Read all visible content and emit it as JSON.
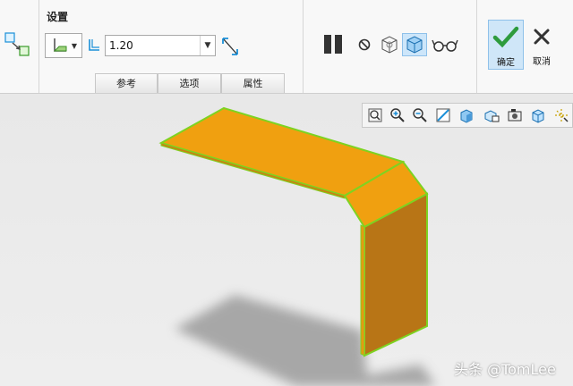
{
  "group_title": "设置",
  "thickness": {
    "value": "1.20"
  },
  "tabs": [
    "参考",
    "选项",
    "属性"
  ],
  "confirm": {
    "label": "确定"
  },
  "cancel": {
    "label": "取消"
  },
  "watermark": "头条 @TomLee",
  "colors": {
    "part_face": "#f0a010",
    "part_side": "#b87516",
    "edge": "#7ed321",
    "accent": "#1a8fd8"
  },
  "icons": {
    "left_command": "sheetmetal-feature-icon",
    "thickness_type": "wall-type-icon",
    "thickness": "thickness-icon",
    "flip": "flip-direction-icon",
    "pause": "pause-icon",
    "no_preview": "no-preview-icon",
    "preview": [
      "wireframe-preview-icon",
      "shaded-preview-icon"
    ],
    "verify": "glasses-verify-icon",
    "view_toolbar": [
      "refit-icon",
      "zoom-in-icon",
      "zoom-out-icon",
      "repaint-icon",
      "display-style-icon",
      "saved-views-icon",
      "named-views-icon",
      "appearance-icon",
      "datum-display-icon"
    ]
  }
}
